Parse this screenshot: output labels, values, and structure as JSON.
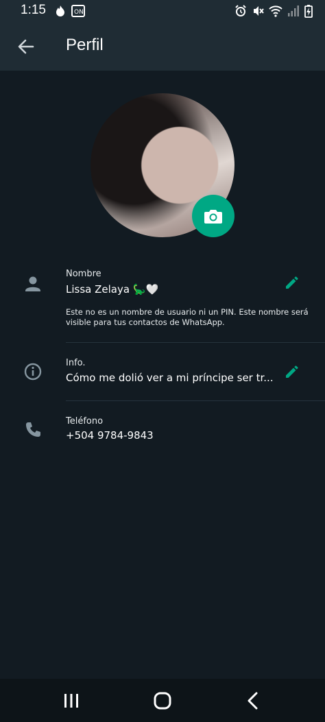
{
  "status_bar": {
    "time": "1:15",
    "left_icons": [
      "fire-icon",
      "notification-app-icon"
    ],
    "right_icons": [
      "alarm-icon",
      "mute-icon",
      "wifi-icon",
      "signal-icon",
      "battery-charging-icon"
    ]
  },
  "app_bar": {
    "title": "Perfil",
    "back_icon": "arrow-back-icon"
  },
  "profile": {
    "camera_icon": "camera-icon"
  },
  "name_section": {
    "label": "Nombre",
    "value": "Lissa Zelaya 🦕🤍",
    "hint": "Este no es un nombre de usuario ni un PIN. Este nombre será visible para tus contactos de WhatsApp."
  },
  "info_section": {
    "label": "Info.",
    "value": "Cómo me dolió ver a mi príncipe ser tr..."
  },
  "phone_section": {
    "label": "Teléfono",
    "value": "+504 9784-9843"
  },
  "colors": {
    "background": "#121b22",
    "appbar": "#1f2c34",
    "accent": "#00a884",
    "icon_gray": "#8696a0"
  },
  "nav_bar": {
    "buttons": [
      "recents-icon",
      "home-icon",
      "back-icon"
    ]
  }
}
